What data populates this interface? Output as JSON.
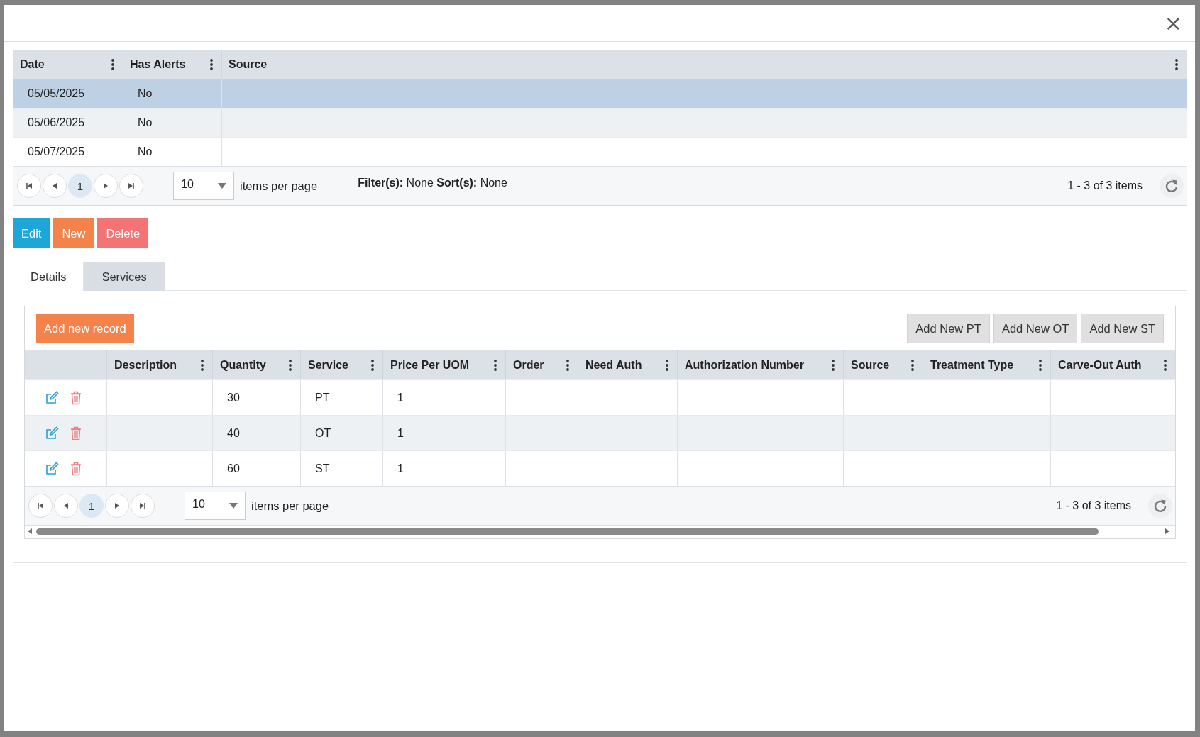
{
  "dialog": {
    "close": "×"
  },
  "top_grid": {
    "columns": [
      {
        "label": "Date"
      },
      {
        "label": "Has Alerts"
      },
      {
        "label": "Source"
      }
    ],
    "rows": [
      {
        "cells": [
          "05/05/2025",
          "No"
        ],
        "selected": true
      },
      {
        "cells": [
          "05/06/2025",
          "No"
        ],
        "selected": false
      },
      {
        "cells": [
          "05/07/2025",
          "No"
        ],
        "selected": false
      }
    ],
    "pager": {
      "page": "1",
      "page_size": "10",
      "page_size_label": "items per page",
      "filters_label": "Filter(s):",
      "filters": "None",
      "sorts_label": "Sort(s):",
      "sorts": "None",
      "summary": "1 - 3 of 3 items"
    }
  },
  "actions": [
    {
      "label": "Edit",
      "kind": "edit"
    },
    {
      "label": "New",
      "kind": "new"
    },
    {
      "label": "Delete",
      "kind": "delete"
    }
  ],
  "tabs": [
    {
      "label": "Details",
      "selected": true
    },
    {
      "label": "Services",
      "selected": false
    }
  ],
  "services_grid": {
    "toolbar": [
      {
        "label": "Add new record",
        "kind": "primary"
      },
      {
        "label": "Add New PT",
        "kind": "default"
      },
      {
        "label": "Add New OT",
        "kind": "default"
      },
      {
        "label": "Add New ST",
        "kind": "default"
      }
    ],
    "columns": [
      {
        "label": "Description"
      },
      {
        "label": "Quantity"
      },
      {
        "label": "Service"
      },
      {
        "label": "Price Per UOM"
      },
      {
        "label": "Order"
      },
      {
        "label": "Need Auth"
      },
      {
        "label": "Authorization Number"
      },
      {
        "label": "Source"
      },
      {
        "label": "Treatment Type"
      },
      {
        "label": "Carve-Out Auth"
      }
    ],
    "rows": [
      {
        "cells": [
          null,
          "30",
          "PT",
          "1"
        ]
      },
      {
        "cells": [
          null,
          "40",
          "OT",
          "1"
        ]
      },
      {
        "cells": [
          null,
          "60",
          "ST",
          "1"
        ]
      }
    ],
    "pager": {
      "page": "1",
      "page_size": "10",
      "page_size_label": "items per page",
      "summary": "1 - 3 of 3 items"
    }
  }
}
